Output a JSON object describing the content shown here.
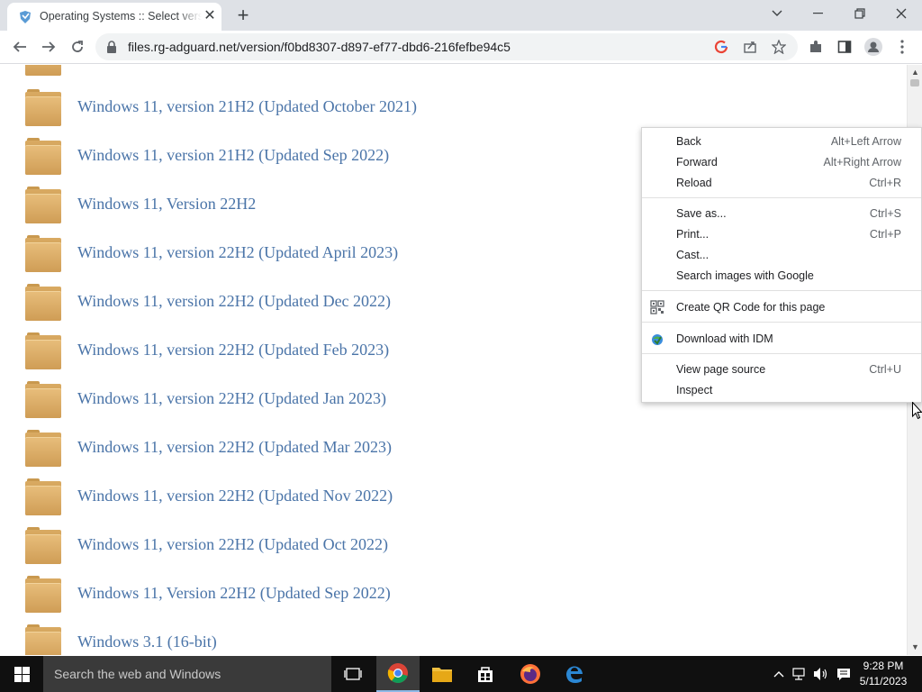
{
  "browser": {
    "tab_title": "Operating Systems :: Select version",
    "url": "files.rg-adguard.net/version/f0bd8307-d897-ef77-dbd6-216fefbe94c5"
  },
  "folders": [
    {
      "label": "Windows 11, version 21H2 (Updated October 2021)"
    },
    {
      "label": "Windows 11, version 21H2 (Updated Sep 2022)"
    },
    {
      "label": "Windows 11, Version 22H2"
    },
    {
      "label": "Windows 11, version 22H2 (Updated April 2023)"
    },
    {
      "label": "Windows 11, version 22H2 (Updated Dec 2022)"
    },
    {
      "label": "Windows 11, version 22H2 (Updated Feb 2023)"
    },
    {
      "label": "Windows 11, version 22H2 (Updated Jan 2023)"
    },
    {
      "label": "Windows 11, version 22H2 (Updated Mar 2023)"
    },
    {
      "label": "Windows 11, version 22H2 (Updated Nov 2022)"
    },
    {
      "label": "Windows 11, version 22H2 (Updated Oct 2022)"
    },
    {
      "label": "Windows 11, Version 22H2 (Updated Sep 2022)"
    },
    {
      "label": "Windows 3.1 (16-bit)"
    }
  ],
  "context_menu": {
    "back": {
      "label": "Back",
      "shortcut": "Alt+Left Arrow"
    },
    "forward": {
      "label": "Forward",
      "shortcut": "Alt+Right Arrow"
    },
    "reload": {
      "label": "Reload",
      "shortcut": "Ctrl+R"
    },
    "save_as": {
      "label": "Save as...",
      "shortcut": "Ctrl+S"
    },
    "print": {
      "label": "Print...",
      "shortcut": "Ctrl+P"
    },
    "cast": {
      "label": "Cast..."
    },
    "search_images": {
      "label": "Search images with Google"
    },
    "qr_code": {
      "label": "Create QR Code for this page"
    },
    "idm": {
      "label": "Download with IDM"
    },
    "view_source": {
      "label": "View page source",
      "shortcut": "Ctrl+U"
    },
    "inspect": {
      "label": "Inspect"
    }
  },
  "taskbar": {
    "search_placeholder": "Search the web and Windows",
    "time": "9:28 PM",
    "date": "5/11/2023"
  },
  "colors": {
    "link": "#4a74a8",
    "folder": "#d9aa62",
    "tabbar": "#dee1e6",
    "taskbar": "#101010"
  }
}
